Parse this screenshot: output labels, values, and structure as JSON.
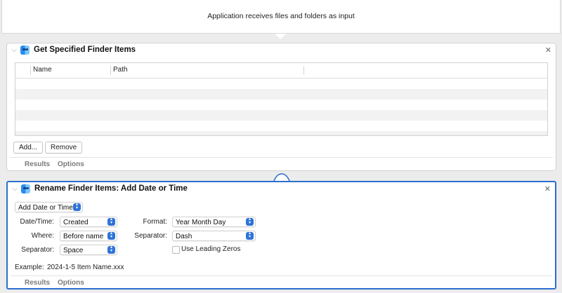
{
  "workflow": {
    "header_text": "Application receives files and folders as input"
  },
  "action1": {
    "title": "Get Specified Finder Items",
    "columns": [
      "Name",
      "Path"
    ],
    "add_label": "Add...",
    "remove_label": "Remove",
    "tabs": [
      "Results",
      "Options"
    ]
  },
  "action2": {
    "title": "Rename Finder Items: Add Date or Time",
    "mode_value": "Add Date or Time",
    "date_time_label": "Date/Time:",
    "date_time_value": "Created",
    "where_label": "Where:",
    "where_value": "Before name",
    "separator1_label": "Separator:",
    "separator1_value": "Space",
    "format_label": "Format:",
    "format_value": "Year Month Day",
    "separator2_label": "Separator:",
    "separator2_value": "Dash",
    "leading_zeros_label": "Use Leading Zeros",
    "leading_zeros_checked": false,
    "example_label": "Example:",
    "example_value": "2024-1-5 Item Name.xxx",
    "tabs": [
      "Results",
      "Options"
    ]
  },
  "icons": {
    "close": "✕",
    "disclosure": "⌵",
    "accent_color": "#2a6fcf"
  }
}
